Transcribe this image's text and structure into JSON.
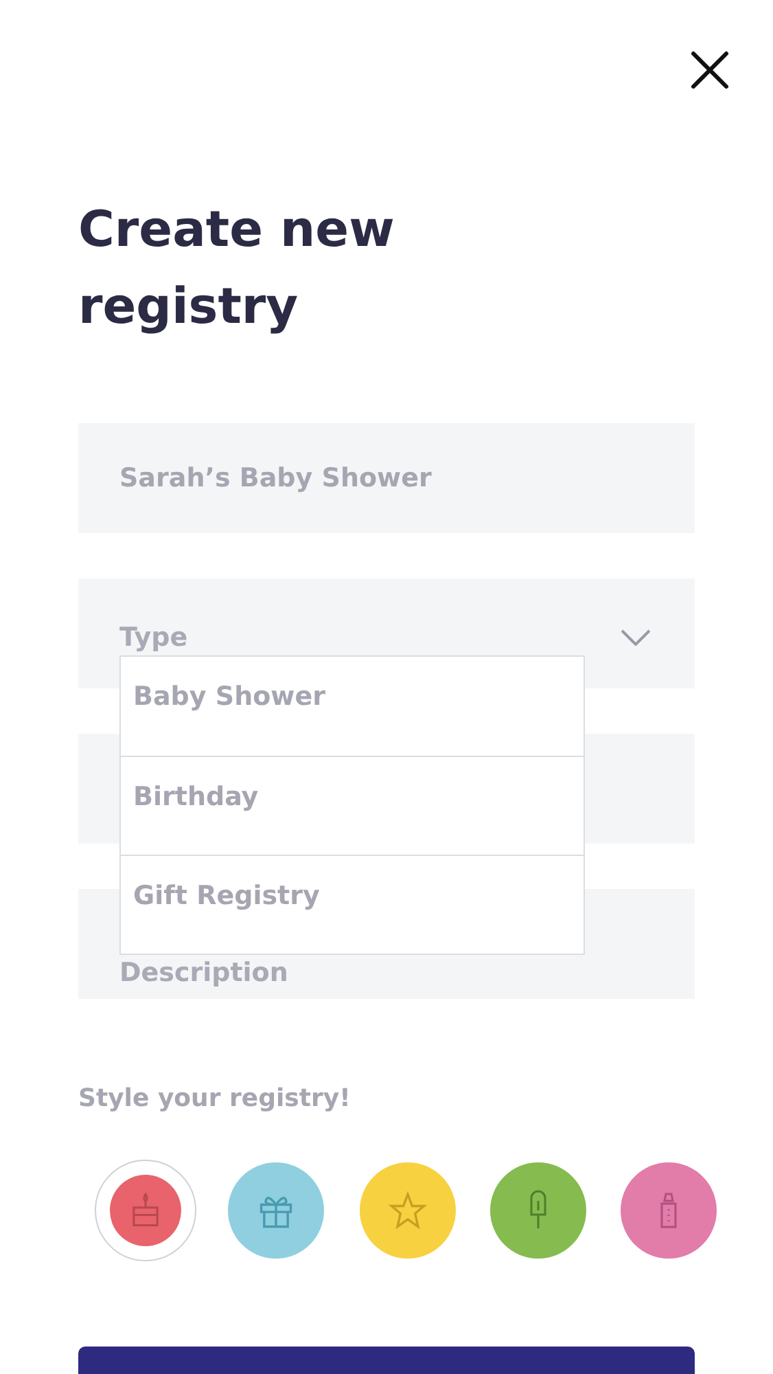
{
  "title": "Create new registry",
  "fields": [
    {
      "kind": "text",
      "value": "Sarah’s Baby Shower"
    },
    {
      "kind": "select",
      "placeholder": "Type",
      "expanded": true,
      "options": [
        {
          "label": "Baby Shower",
          "selected": false
        },
        {
          "label": "Birthday",
          "selected": false
        },
        {
          "label": "Gift Registry",
          "selected": false
        }
      ]
    },
    {
      "kind": "text"
    },
    {
      "kind": "text",
      "placeholder": "Description"
    }
  ],
  "style_label": "Style your registry!",
  "swatches": [
    {
      "kind": "cake",
      "color": "#e8636b",
      "selected": true
    },
    {
      "kind": "gift",
      "color": "#8fcfe0",
      "selected": false
    },
    {
      "kind": "star",
      "color": "#f8d140",
      "selected": false
    },
    {
      "kind": "popsicle",
      "color": "#86bb4f",
      "selected": false
    },
    {
      "kind": "bottle",
      "color": "#e27ca8",
      "selected": false
    }
  ]
}
